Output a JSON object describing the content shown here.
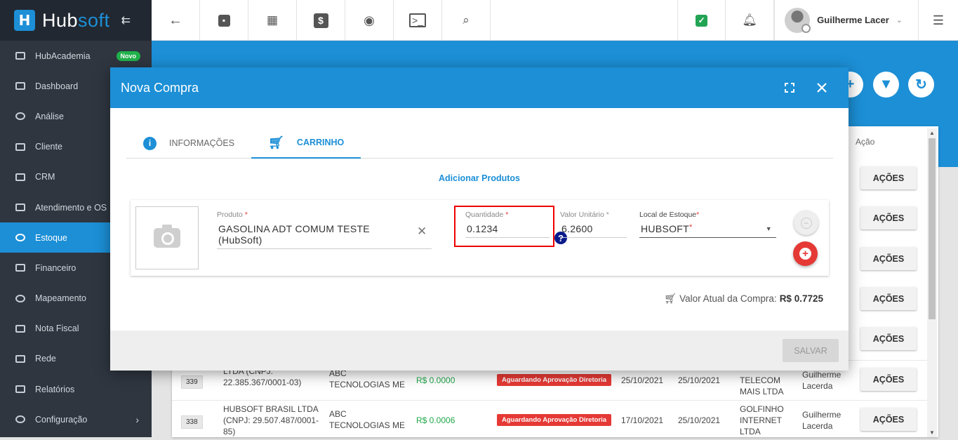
{
  "brand": {
    "logo_letter": "H",
    "name_part1": "Hub",
    "name_part2": "soft"
  },
  "sidebar": {
    "items": [
      {
        "label": "HubAcademia",
        "badge": "Novo"
      },
      {
        "label": "Dashboard"
      },
      {
        "label": "Análise"
      },
      {
        "label": "Cliente"
      },
      {
        "label": "CRM"
      },
      {
        "label": "Atendimento e OS"
      },
      {
        "label": "Estoque",
        "active": true
      },
      {
        "label": "Financeiro"
      },
      {
        "label": "Mapeamento"
      },
      {
        "label": "Nota Fiscal"
      },
      {
        "label": "Rede"
      },
      {
        "label": "Relatórios"
      },
      {
        "label": "Configuração",
        "chevron": "›"
      }
    ]
  },
  "topbar": {
    "user_name": "Guilherme Lacer"
  },
  "table": {
    "header_acao": "Ação",
    "actions_label": "AÇÕES",
    "rows": [
      {
        "id": "339",
        "cliente": "LTDA (CNPJ: 22.385.367/0001-03)",
        "empresa": "ABC TECNOLOGIAS ME",
        "valor": "R$ 0.0000",
        "status": "Aguardando Aprovação Diretoria",
        "data1": "25/10/2021",
        "data2": "25/10/2021",
        "fornecedor": "TELECOM MAIS LTDA",
        "usuario": "Guilherme Lacerda"
      },
      {
        "id": "338",
        "cliente": "HUBSOFT BRASIL LTDA (CNPJ: 29.507.487/0001-85)",
        "empresa": "ABC TECNOLOGIAS ME",
        "valor": "R$ 0.0006",
        "status": "Aguardando Aprovação Diretoria",
        "data1": "17/10/2021",
        "data2": "25/10/2021",
        "fornecedor": "GOLFINHO INTERNET LTDA",
        "usuario": "Guilherme Lacerda"
      }
    ]
  },
  "modal": {
    "title": "Nova Compra",
    "tabs": [
      {
        "label": "INFORMAÇÕES"
      },
      {
        "label": "CARRINHO",
        "active": true
      }
    ],
    "add_products": "Adicionar Produtos",
    "product": {
      "produto_label": "Produto",
      "produto_value": "GASOLINA ADT COMUM TESTE (HubSoft)",
      "quantidade_label": "Quantidade",
      "quantidade_value": "0.1234",
      "valor_label": "Valor Unitário",
      "valor_value": "6.2600",
      "local_label": "Local de Estoque",
      "local_value": "HUBSOFT",
      "required_mark": "*"
    },
    "total_label": "Valor Atual da Compra:",
    "total_value": "R$ 0.7725",
    "save_label": "SALVAR"
  },
  "colors": {
    "primary": "#1c8fd6",
    "sidebar": "#2f3640",
    "danger": "#e53935",
    "success": "#21a84a"
  }
}
